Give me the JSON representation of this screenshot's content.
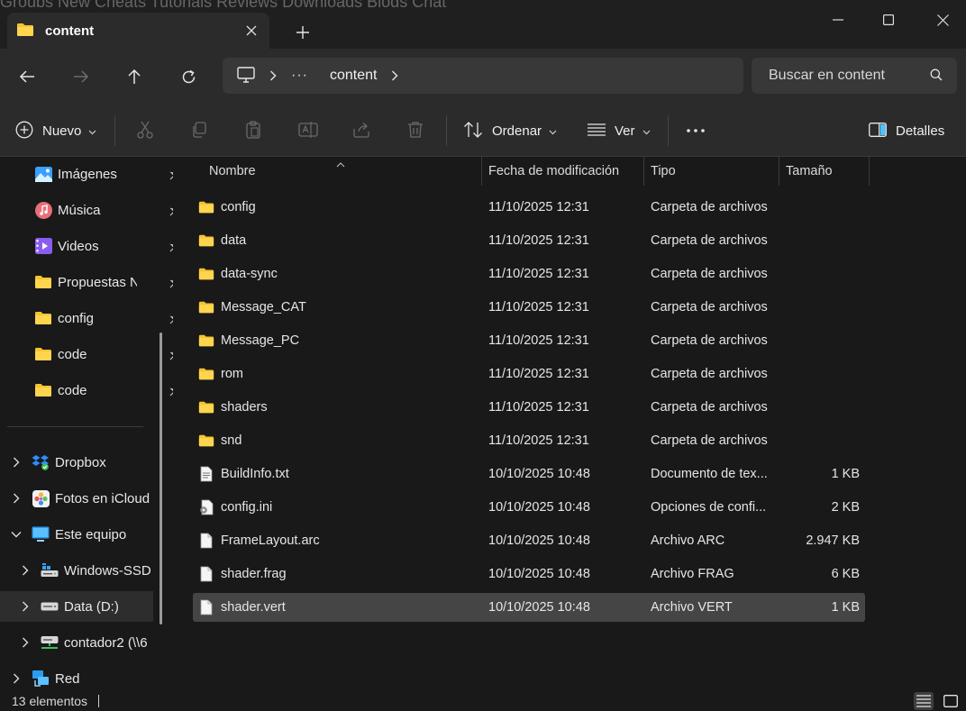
{
  "window": {
    "tab_title": "content",
    "behind_tabs": "Groups      New      Cheats      Tutorials      Reviews      Downloads      Blogs      Chat"
  },
  "address": {
    "crumb": "content",
    "search_placeholder": "Buscar en content"
  },
  "toolbar": {
    "new_label": "Nuevo",
    "sort_label": "Ordenar",
    "view_label": "Ver",
    "details_label": "Detalles"
  },
  "sidebar": {
    "pinned": [
      {
        "label": "Imágenes",
        "icon": "pictures-icon"
      },
      {
        "label": "Música",
        "icon": "music-icon"
      },
      {
        "label": "Videos",
        "icon": "videos-icon"
      },
      {
        "label": "Propuestas N",
        "icon": "folder-icon"
      },
      {
        "label": "config",
        "icon": "folder-icon"
      },
      {
        "label": "code",
        "icon": "folder-icon"
      },
      {
        "label": "code",
        "icon": "folder-icon"
      }
    ],
    "tree": [
      {
        "label": "Dropbox",
        "icon": "dropbox-icon"
      },
      {
        "label": "Fotos en iCloud",
        "icon": "icloud-photos-icon"
      },
      {
        "label": "Este equipo",
        "icon": "this-pc-icon"
      },
      {
        "label": "Windows-SSD",
        "icon": "drive-icon"
      },
      {
        "label": "Data (D:)",
        "icon": "drive-icon"
      },
      {
        "label": "contador2 (\\\\6",
        "icon": "network-drive-icon"
      },
      {
        "label": "Red",
        "icon": "network-icon"
      }
    ]
  },
  "columns": {
    "name": "Nombre",
    "date": "Fecha de modificación",
    "type": "Tipo",
    "size": "Tamaño"
  },
  "files": [
    {
      "name": "config",
      "date": "11/10/2025 12:31",
      "type": "Carpeta de archivos",
      "size": "",
      "icon": "folder-icon"
    },
    {
      "name": "data",
      "date": "11/10/2025 12:31",
      "type": "Carpeta de archivos",
      "size": "",
      "icon": "folder-icon"
    },
    {
      "name": "data-sync",
      "date": "11/10/2025 12:31",
      "type": "Carpeta de archivos",
      "size": "",
      "icon": "folder-icon"
    },
    {
      "name": "Message_CAT",
      "date": "11/10/2025 12:31",
      "type": "Carpeta de archivos",
      "size": "",
      "icon": "folder-icon"
    },
    {
      "name": "Message_PC",
      "date": "11/10/2025 12:31",
      "type": "Carpeta de archivos",
      "size": "",
      "icon": "folder-icon"
    },
    {
      "name": "rom",
      "date": "11/10/2025 12:31",
      "type": "Carpeta de archivos",
      "size": "",
      "icon": "folder-icon"
    },
    {
      "name": "shaders",
      "date": "11/10/2025 12:31",
      "type": "Carpeta de archivos",
      "size": "",
      "icon": "folder-icon"
    },
    {
      "name": "snd",
      "date": "11/10/2025 12:31",
      "type": "Carpeta de archivos",
      "size": "",
      "icon": "folder-icon"
    },
    {
      "name": "BuildInfo.txt",
      "date": "10/10/2025 10:48",
      "type": "Documento de tex...",
      "size": "1 KB",
      "icon": "text-file-icon"
    },
    {
      "name": "config.ini",
      "date": "10/10/2025 10:48",
      "type": "Opciones de confi...",
      "size": "2 KB",
      "icon": "settings-file-icon"
    },
    {
      "name": "FrameLayout.arc",
      "date": "10/10/2025 10:48",
      "type": "Archivo ARC",
      "size": "2.947 KB",
      "icon": "file-icon"
    },
    {
      "name": "shader.frag",
      "date": "10/10/2025 10:48",
      "type": "Archivo FRAG",
      "size": "6 KB",
      "icon": "file-icon"
    },
    {
      "name": "shader.vert",
      "date": "10/10/2025 10:48",
      "type": "Archivo VERT",
      "size": "1 KB",
      "icon": "file-icon"
    }
  ],
  "status": {
    "count": "13 elementos"
  },
  "colors": {
    "folder": "#f4c430",
    "accent": "#4cc2ff"
  }
}
